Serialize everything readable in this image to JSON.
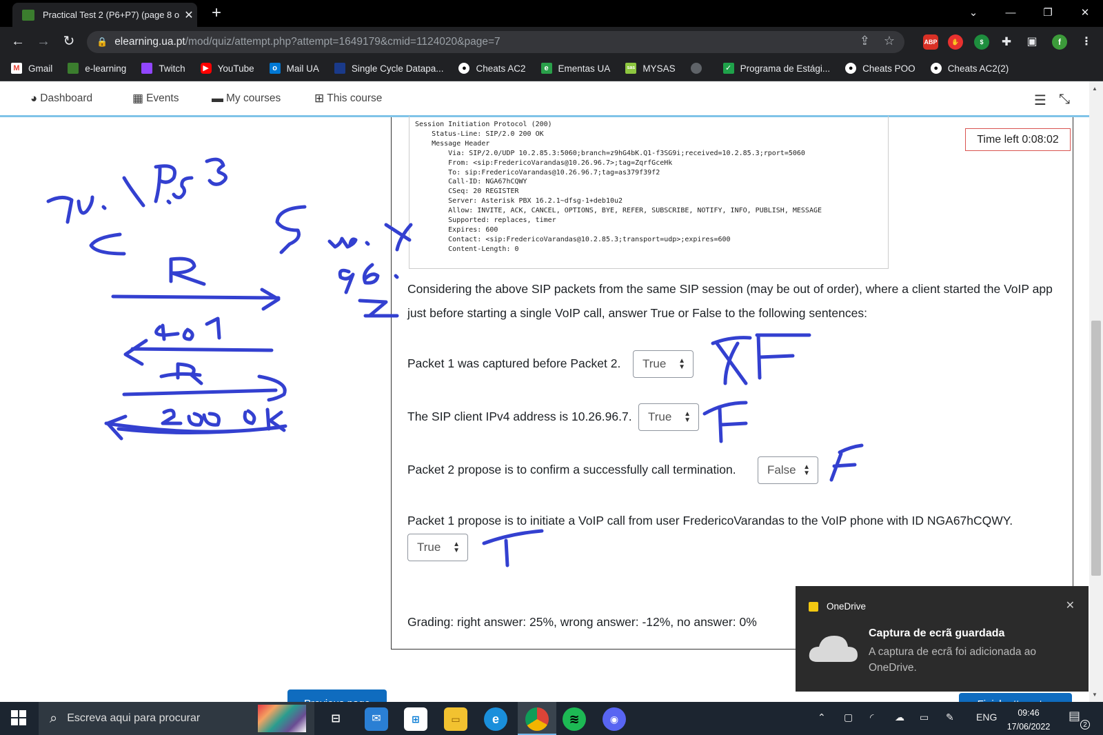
{
  "browser": {
    "tab_title": "Practical Test 2 (P6+P7) (page 8 o",
    "url_host": "elearning.ua.pt",
    "url_path": "/mod/quiz/attempt.php?attempt=1649179&cmid=1124020&page=7"
  },
  "bookmarks": [
    {
      "label": "Gmail",
      "icon": "gmail-icon",
      "color": "#ea4335"
    },
    {
      "label": "e-learning",
      "icon": "elearning-icon",
      "color": "#3b7d2e"
    },
    {
      "label": "Twitch",
      "icon": "twitch-icon",
      "color": "#9146ff"
    },
    {
      "label": "YouTube",
      "icon": "youtube-icon",
      "color": "#ff0000"
    },
    {
      "label": "Mail UA",
      "icon": "mail-icon",
      "color": "#0078d4"
    },
    {
      "label": "Single Cycle Datapa...",
      "icon": "datapath-icon",
      "color": "#1a3a8a"
    },
    {
      "label": "Cheats AC2",
      "icon": "github-icon",
      "color": "#202124"
    },
    {
      "label": "Ementas UA",
      "icon": "ementas-icon",
      "color": "#2aa04a"
    },
    {
      "label": "MYSAS",
      "icon": "mysas-icon",
      "color": "#8dc63f"
    },
    {
      "label": "",
      "icon": "globe-icon",
      "color": "#5f6368"
    },
    {
      "label": "Programa de Estági...",
      "icon": "programa-icon",
      "color": "#1fa24a"
    },
    {
      "label": "Cheats POO",
      "icon": "github-icon",
      "color": "#202124"
    },
    {
      "label": "Cheats AC2(2)",
      "icon": "github-icon",
      "color": "#202124"
    }
  ],
  "nav": {
    "dashboard": "Dashboard",
    "events": "Events",
    "my_courses": "My courses",
    "this_course": "This course"
  },
  "timer": "Time left 0:08:02",
  "packet_lines": [
    "Session Initiation Protocol (200)",
    "    Status-Line: SIP/2.0 200 OK",
    "    Message Header",
    "        Via: SIP/2.0/UDP 10.2.85.3:5060;branch=z9hG4bK.Q1-f3SG9i;received=10.2.85.3;rport=5060",
    "        From: <sip:FredericoVarandas@10.26.96.7>;tag=ZqrfGceHk",
    "        To: sip:FredericoVarandas@10.26.96.7;tag=as379f39f2",
    "        Call-ID: NGA67hCQWY",
    "        CSeq: 20 REGISTER",
    "        Server: Asterisk PBX 16.2.1~dfsg-1+deb10u2",
    "        Allow: INVITE, ACK, CANCEL, OPTIONS, BYE, REFER, SUBSCRIBE, NOTIFY, INFO, PUBLISH, MESSAGE",
    "        Supported: replaces, timer",
    "        Expires: 600",
    "        Contact: <sip:FredericoVarandas@10.2.85.3;transport=udp>;expires=600",
    "        Content-Length: 0"
  ],
  "question": {
    "intro": "Considering the above SIP packets from the same SIP session (may be out of order), where a client started the VoIP app just before starting a single VoIP call, answer True or False to the following sentences:",
    "statements": [
      {
        "text": "Packet 1 was captured before Packet 2.",
        "answer": "True"
      },
      {
        "text": "The SIP client IPv4 address is 10.26.96.7.",
        "answer": "True"
      },
      {
        "text": "Packet 2 propose is to confirm a successfully call termination.",
        "answer": "False"
      },
      {
        "text": "Packet 1 propose is to initiate a VoIP call from user FredericoVarandas to the VoIP phone with ID NGA67hCQWY.",
        "answer": "True"
      }
    ],
    "grading": "Grading: right answer: 25%, wrong answer: -12%, no answer: 0%"
  },
  "buttons": {
    "previous": "Previous page",
    "finish": "Finish attempt ..."
  },
  "toast": {
    "app": "OneDrive",
    "title": "Captura de ecrã guardada",
    "body": "A captura de ecrã foi adicionada ao OneDrive."
  },
  "taskbar": {
    "search_placeholder": "Escreva aqui para procurar",
    "language": "ENG",
    "time": "09:46",
    "date": "17/06/2022",
    "notification_count": "2"
  },
  "colors": {
    "ink": "#3340d0",
    "moodle_blue": "#0f6cbf",
    "nav_accent": "#7fc3e8",
    "timer_border": "#d9534f"
  }
}
